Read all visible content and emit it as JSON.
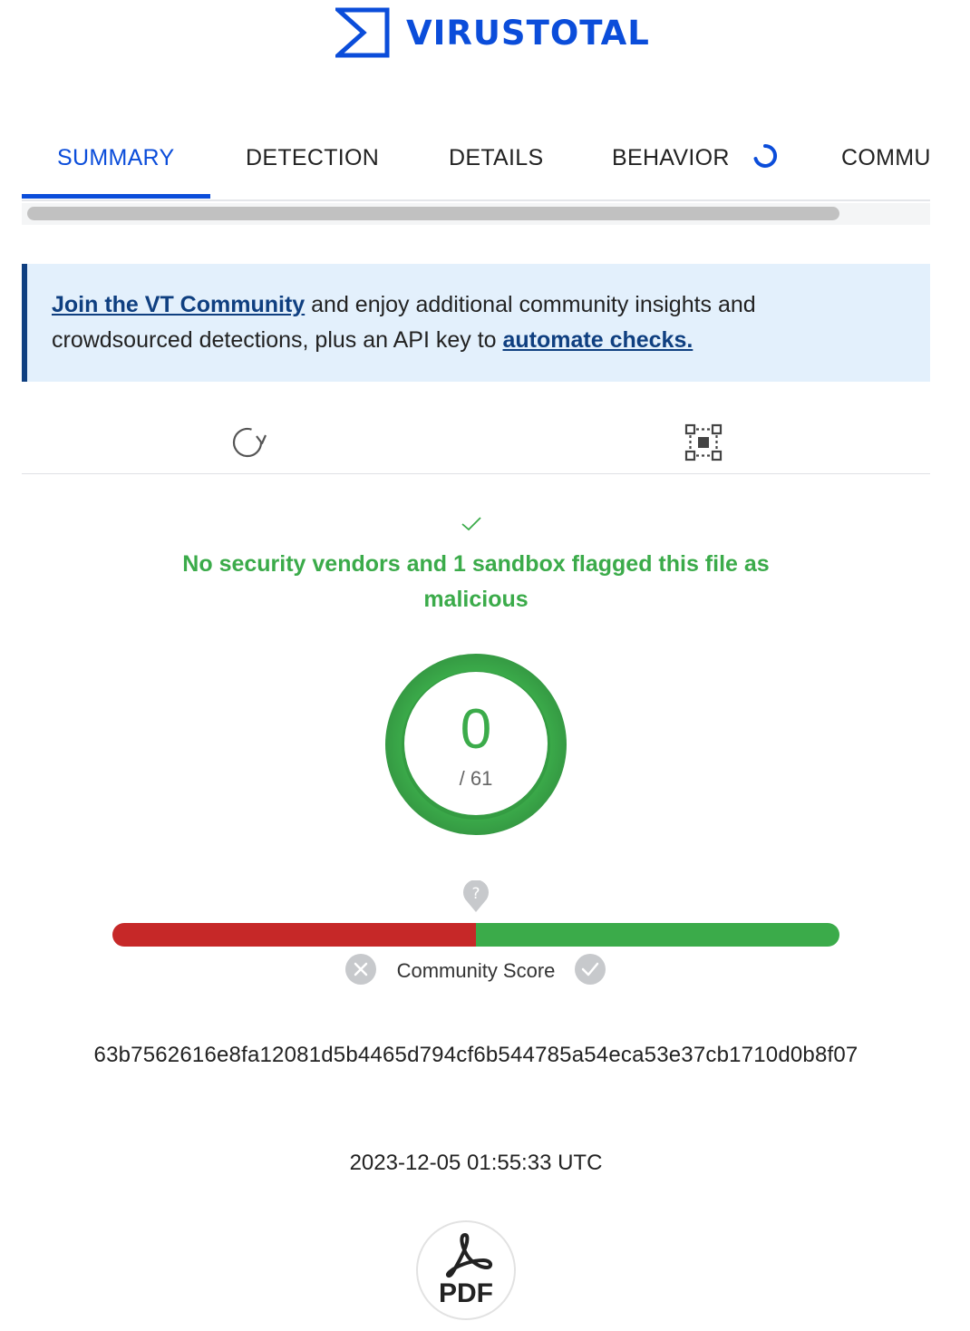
{
  "brand": {
    "name": "VIRUSTOTAL",
    "logo_icon": "virustotal-sigma-logo",
    "color": "#0b4dda"
  },
  "tabs": [
    {
      "label": "SUMMARY",
      "active": true
    },
    {
      "label": "DETECTION",
      "active": false
    },
    {
      "label": "DETAILS",
      "active": false
    },
    {
      "label": "BEHAVIOR",
      "active": false,
      "loading": true
    },
    {
      "label": "COMMU",
      "active": false
    }
  ],
  "banner": {
    "link1": "Join the VT Community",
    "text1": " and enjoy additional community insights and crowdsourced detections, plus an API key to ",
    "link2": "automate checks."
  },
  "actions": {
    "reanalyze_icon": "refresh-icon",
    "similar_icon": "graph-nodes-icon"
  },
  "verdict": {
    "icon": "check-icon",
    "text": "No security vendors and 1 sandbox flagged this file as malicious",
    "color": "#3bab4a"
  },
  "score": {
    "detections": "0",
    "total": "/ 61",
    "ring_color": "#3bab4a"
  },
  "community": {
    "label": "Community Score",
    "help_icon": "question-pin-icon",
    "bad_color": "#c62828",
    "good_color": "#3bab4a"
  },
  "file": {
    "hash": "63b7562616e8fa12081d5b4465d794cf6b544785a54eca53e37cb1710d0b8f07",
    "date": "2023-12-05 01:55:33 UTC",
    "type_label": "PDF",
    "type_icon": "pdf-icon"
  }
}
